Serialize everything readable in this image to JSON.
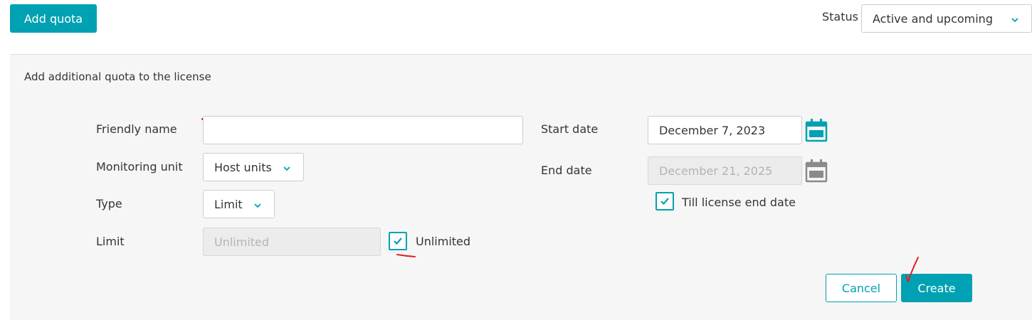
{
  "toolbar": {
    "add_quota_label": "Add quota",
    "status_label": "Status",
    "status_value": "Active and upcoming"
  },
  "panel": {
    "title": "Add additional quota to the license"
  },
  "form": {
    "friendly_name": {
      "label": "Friendly name",
      "value": "",
      "placeholder": ""
    },
    "monitoring_unit": {
      "label": "Monitoring unit",
      "value": "Host units"
    },
    "type": {
      "label": "Type",
      "value": "Limit"
    },
    "limit": {
      "label": "Limit",
      "value": "Unlimited",
      "checkbox_label": "Unlimited",
      "checkbox_checked": true
    },
    "start_date": {
      "label": "Start date",
      "value": "December 7, 2023"
    },
    "end_date": {
      "label": "End date",
      "value": "December 21, 2025",
      "checkbox_label": "Till license end date",
      "checkbox_checked": true
    }
  },
  "actions": {
    "cancel_label": "Cancel",
    "create_label": "Create"
  },
  "colors": {
    "accent": "#00a1b2",
    "panel_bg": "#f6f6f6",
    "annotation_red": "#e0202a"
  },
  "icons": {
    "dropdown": "chevron-down-icon",
    "calendar": "calendar-icon",
    "check": "check-icon"
  }
}
